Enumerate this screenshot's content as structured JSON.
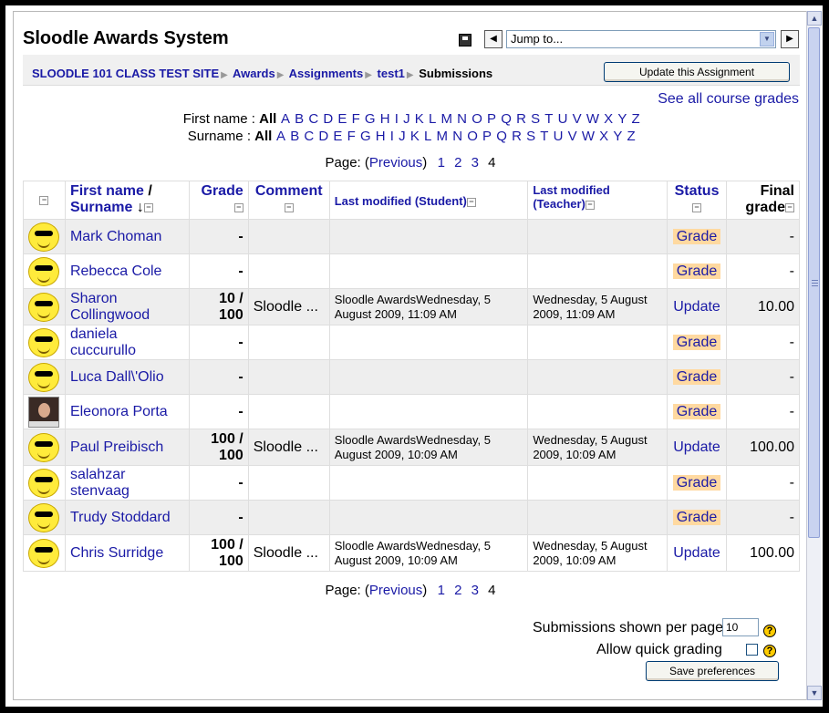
{
  "header": {
    "title": "Sloodle Awards System",
    "jump_placeholder": "Jump to...",
    "prev_arrow": "◀",
    "next_arrow": "▶"
  },
  "breadcrumb": {
    "items": [
      "SLOODLE 101 CLASS TEST SITE",
      "Awards",
      "Assignments",
      "test1"
    ],
    "current": "Submissions",
    "update_button": "Update this Assignment"
  },
  "see_all_link": "See all course grades",
  "filters": {
    "first_label": "First name :",
    "surname_label": "Surname :",
    "all": "All",
    "letters": [
      "A",
      "B",
      "C",
      "D",
      "E",
      "F",
      "G",
      "H",
      "I",
      "J",
      "K",
      "L",
      "M",
      "N",
      "O",
      "P",
      "Q",
      "R",
      "S",
      "T",
      "U",
      "V",
      "W",
      "X",
      "Y",
      "Z"
    ]
  },
  "pager": {
    "label": "Page:",
    "prev_open": "(",
    "prev": "Previous",
    "prev_close": ")",
    "pages": [
      "1",
      "2",
      "3"
    ],
    "current": "4"
  },
  "table": {
    "headers": {
      "first_name": "First name",
      "slash": "/",
      "surname": "Surname",
      "grade": "Grade",
      "comment": "Comment",
      "last_modified_student": "Last modified (Student)",
      "last_modified_teacher_1": "Last modified",
      "last_modified_teacher_2": "(Teacher)",
      "status": "Status",
      "final_grade_1": "Final",
      "final_grade_2": "grade"
    },
    "rows": [
      {
        "name": "Mark Choman",
        "grade": "-",
        "comment": "",
        "student": "",
        "teacher": "",
        "status": "Grade",
        "final": "-",
        "pic": "smiley"
      },
      {
        "name": "Rebecca Cole",
        "grade": "-",
        "comment": "",
        "student": "",
        "teacher": "",
        "status": "Grade",
        "final": "-",
        "pic": "smiley"
      },
      {
        "name": "Sharon Collingwood",
        "grade": "10 / 100",
        "comment": "Sloodle ...",
        "student": "Sloodle AwardsWednesday, 5 August 2009, 11:09 AM",
        "teacher": "Wednesday, 5 August 2009, 11:09 AM",
        "status": "Update",
        "final": "10.00",
        "pic": "smiley"
      },
      {
        "name": "daniela cuccurullo",
        "grade": "-",
        "comment": "",
        "student": "",
        "teacher": "",
        "status": "Grade",
        "final": "-",
        "pic": "smiley"
      },
      {
        "name": "Luca Dall\\'Olio",
        "grade": "-",
        "comment": "",
        "student": "",
        "teacher": "",
        "status": "Grade",
        "final": "-",
        "pic": "smiley"
      },
      {
        "name": "Eleonora Porta",
        "grade": "-",
        "comment": "",
        "student": "",
        "teacher": "",
        "status": "Grade",
        "final": "-",
        "pic": "photo"
      },
      {
        "name": "Paul Preibisch",
        "grade": "100 / 100",
        "comment": "Sloodle ...",
        "student": "Sloodle AwardsWednesday, 5 August 2009, 10:09 AM",
        "teacher": "Wednesday, 5 August 2009, 10:09 AM",
        "status": "Update",
        "final": "100.00",
        "pic": "smiley"
      },
      {
        "name": "salahzar stenvaag",
        "grade": "-",
        "comment": "",
        "student": "",
        "teacher": "",
        "status": "Grade",
        "final": "-",
        "pic": "smiley"
      },
      {
        "name": "Trudy Stoddard",
        "grade": "-",
        "comment": "",
        "student": "",
        "teacher": "",
        "status": "Grade",
        "final": "-",
        "pic": "smiley"
      },
      {
        "name": "Chris Surridge",
        "grade": "100 / 100",
        "comment": "Sloodle ...",
        "student": "Sloodle AwardsWednesday, 5 August 2009, 10:09 AM",
        "teacher": "Wednesday, 5 August 2009, 10:09 AM",
        "status": "Update",
        "final": "100.00",
        "pic": "smiley"
      }
    ]
  },
  "preferences": {
    "per_page_label": "Submissions shown per page",
    "per_page_value": "10",
    "quick_grading_label": "Allow quick grading",
    "save_button": "Save preferences",
    "help": "?"
  }
}
